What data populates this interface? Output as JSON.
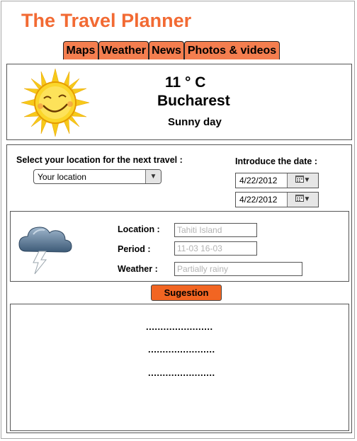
{
  "app": {
    "title": "The Travel Planner"
  },
  "nav": {
    "tabs": [
      {
        "label": "Maps"
      },
      {
        "label": "Weather"
      },
      {
        "label": "News"
      },
      {
        "label": "Photos & videos"
      }
    ]
  },
  "current_weather": {
    "temperature": "11 ° C",
    "city": "Bucharest",
    "description": "Sunny day",
    "icon": "sun-icon"
  },
  "planner": {
    "location_label": "Select your location for the next travel :",
    "location_select": {
      "value": "Your location"
    },
    "date_label": "Introduce the date :",
    "dates": [
      {
        "value": "4/22/2012"
      },
      {
        "value": "4/22/2012"
      }
    ]
  },
  "forecast": {
    "icon": "storm-cloud-icon",
    "location_label": "Location :",
    "location_value": "Tahiti Island",
    "period_label": "Period :",
    "period_value": "11-03 16-03",
    "weather_label": "Weather :",
    "weather_value": "Partially rainy"
  },
  "suggestion": {
    "button_label": "Sugestion",
    "results": [
      ".......................",
      ".......................",
      "......................."
    ]
  },
  "colors": {
    "accent": "#f26a33",
    "tab_fill": "#f47e4f",
    "button_fill": "#f26522",
    "placeholder_text": "#b3b3b3"
  }
}
